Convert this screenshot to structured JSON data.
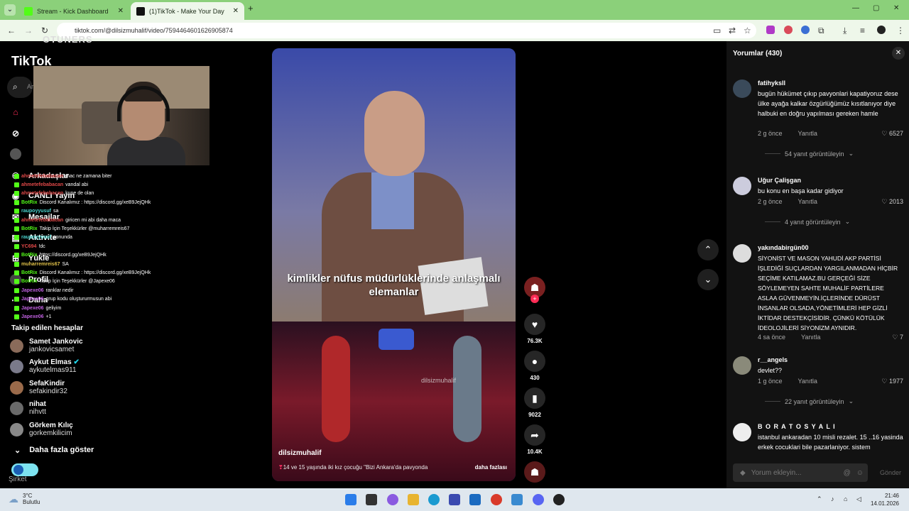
{
  "browser": {
    "tabs": [
      {
        "title": "Stream - Kick Dashboard"
      },
      {
        "title": "(1)TikTok - Make Your Day"
      }
    ],
    "url": "tiktok.com/@dilsizmuhalif/video/7594464601626905874"
  },
  "sidebar": {
    "logo": "TikTok",
    "overlay_logo": "OTUNERS",
    "search_placeholder": "Ar",
    "nav": [
      "Arkadaşlar",
      "CANLI Yayın",
      "Mesajlar",
      "Aktivite",
      "Yükle",
      "Profil",
      "Daha"
    ],
    "following_title": "Takip edilen hesaplar",
    "following": [
      {
        "name": "Samet Jankovic",
        "user": "jankovicsamet"
      },
      {
        "name": "Aykut Elmas",
        "user": "aykutelmas911"
      },
      {
        "name": "SefaKindir",
        "user": "sefakindir32"
      },
      {
        "name": "nihat",
        "user": "nihvtt"
      },
      {
        "name": "Görkem Kılıç",
        "user": "gorkemkilicim"
      }
    ],
    "more_label": "Daha fazla göster",
    "company": "Şirket"
  },
  "stream_chat": [
    {
      "user": "ahmetefebabacan",
      "msg": "mac ne zamana biter"
    },
    {
      "user": "ahmetefebabacan",
      "msg": "vandal abi"
    },
    {
      "user": "ahmetefebabacan",
      "msg": "kune de olan"
    },
    {
      "user": "BotRix",
      "msg": "Discord Kanalımız : https://discord.gg/xeB9JejQHk"
    },
    {
      "user": "raupoyyusuf",
      "msg": "sa"
    },
    {
      "user": "ahmetefebabacan",
      "msg": "giricen mi abi daha maca"
    },
    {
      "user": "BotRix",
      "msg": "Takip İçin Teşekkürler @muharremreis67"
    },
    {
      "user": "raupoyyusuf",
      "msg": "sonunda"
    },
    {
      "user": "YC694",
      "msg": "!dc"
    },
    {
      "user": "BotRix",
      "msg": "https://discord.gg/xeB9JejQHk"
    },
    {
      "user": "muharremreis67",
      "msg": "SA"
    },
    {
      "user": "BotRix",
      "msg": "Discord Kanalımız : https://discord.gg/xeB9JejQHk"
    },
    {
      "user": "BotRix",
      "msg": "Takip İçin Teşekkürler @Japexe06"
    },
    {
      "user": "Japexe06",
      "msg": "ranklar nedir"
    },
    {
      "user": "Japexe06",
      "msg": "grup kodu oluştururmusun abi"
    },
    {
      "user": "Japexe06",
      "msg": "geliyim"
    },
    {
      "user": "Japexe06",
      "msg": "+1"
    }
  ],
  "video": {
    "caption": "kimlikler nüfus müdürlüklerinde anlaşmalı elemanlar",
    "watermark": "dilsizmuhalif",
    "username": "dilsizmuhalif",
    "description": "14 ve 15 yaşında iki kız çocuğu \"Bizi Ankara'da pavyonda",
    "more": "daha fazlası",
    "likes": "76.3K",
    "comments": "430",
    "saves": "9022",
    "shares": "10.4K"
  },
  "comments": {
    "header": "Yorumlar (430)",
    "list": [
      {
        "name": "fatihyksll",
        "text": "bugün hükümet çıkıp pavyonlari kapatiyoruz dese ülke ayağa kalkar özgürlüğümüz kısıtlanıyor diye halbuki en doğru yapılması gereken hamle",
        "time": "2 g önce",
        "reply": "Yanıtla",
        "likes": "6527",
        "replies": "54 yanıt görüntüleyin"
      },
      {
        "name": "Uğur Çalişgan",
        "text": "bu konu en başa kadar gidiyor",
        "time": "2 g önce",
        "reply": "Yanıtla",
        "likes": "2013",
        "replies": "4 yanıt görüntüleyin"
      },
      {
        "name": "yakındabirgün00",
        "text": "SİYONİST VE MASON YAHUDİ AKP PARTİSİ İŞLEDİĞİ SUÇLARDAN YARGILANMADAN HİÇBİR SEÇİME KATILAMAZ.BU GERÇEĞİ SİZE SÖYLEMEYEN SAHTE MUHALİF PARTİLERE ASLAA GÜVENMEYİN.İÇLERİNDE DÜRÜST İNSANLAR OLSADA,YÖNETİMLERİ HEP GİZLİ İKTİDAR DESTEKÇİSİDİR. ÇÜNKÜ KÖTÜLÜK İDEOLOJİLERİ SİYONİZM AYNIDIR.",
        "time": "4 sa önce",
        "reply": "Yanıtla",
        "likes": "7",
        "replies": ""
      },
      {
        "name": "r__angels",
        "text": "devlet??",
        "time": "1 g önce",
        "reply": "Yanıtla",
        "likes": "1977",
        "replies": "22 yanıt görüntüleyin"
      },
      {
        "name": "B O R A T O S Y A L I",
        "text": "istanbul ankaradan 10 misli rezalet. 15 ..16 yasinda erkek cocuklari bile pazarlaniyor. sistem",
        "time": "",
        "reply": "",
        "likes": "",
        "replies": ""
      }
    ],
    "input_placeholder": "Yorum ekleyin...",
    "send": "Gönder"
  },
  "taskbar": {
    "weather_temp": "3°C",
    "weather_desc": "Bulutlu",
    "time": "21:46",
    "date": "14.01.2026"
  }
}
